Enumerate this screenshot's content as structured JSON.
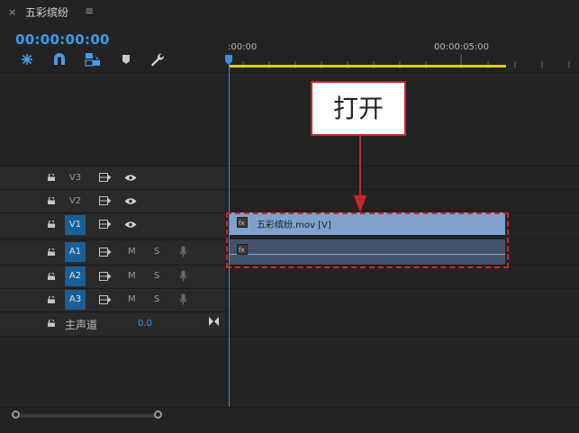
{
  "panel": {
    "close_glyph": "×",
    "sequence_name": "五彩缤纷",
    "menu_glyph": "≡",
    "timecode": "00:00:00:00"
  },
  "toolbar": {
    "tools": [
      {
        "icon": "snap-nest-icon"
      },
      {
        "icon": "magnet-snap-icon"
      },
      {
        "icon": "linked-selection-icon"
      },
      {
        "icon": "add-marker-icon"
      },
      {
        "icon": "wrench-settings-icon"
      }
    ]
  },
  "ruler": {
    "labels": [
      ":00:00",
      "00:00:05:00"
    ]
  },
  "tracks": {
    "video": [
      {
        "label": "V3",
        "active": false
      },
      {
        "label": "V2",
        "active": false
      },
      {
        "label": "V1",
        "active": true
      }
    ],
    "audio": [
      {
        "label": "A1",
        "active": true,
        "mute": "M",
        "solo": "S"
      },
      {
        "label": "A2",
        "active": true,
        "mute": "M",
        "solo": "S"
      },
      {
        "label": "A3",
        "active": true,
        "mute": "M",
        "solo": "S"
      }
    ],
    "master": {
      "label": "主声道",
      "value": "0.0"
    }
  },
  "clips": {
    "video_clip_name": "五彩缤纷.mov [V]"
  },
  "callout": {
    "text": "打开",
    "color": "#c8262a"
  },
  "colors": {
    "accent_blue": "#3b9bf0",
    "work_area": "#d8cc2a",
    "video_clip": "#7fa2cc",
    "audio_clip": "#43536b"
  }
}
